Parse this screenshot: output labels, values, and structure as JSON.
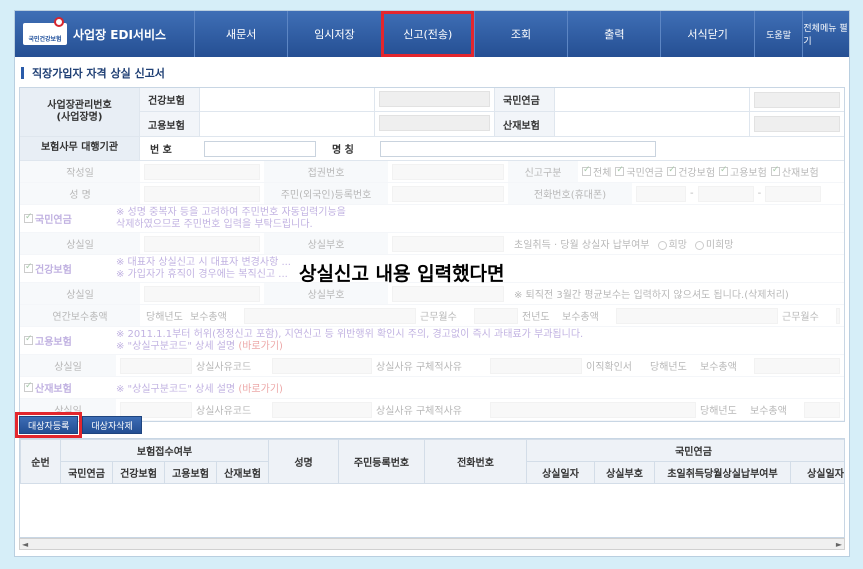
{
  "nav": {
    "logo_badge": "국민건강보험",
    "title": "사업장 EDI서비스",
    "items": [
      {
        "label": "새문서"
      },
      {
        "label": "임시저장"
      },
      {
        "label": "신고(전송)"
      },
      {
        "label": "조회"
      },
      {
        "label": "출력"
      },
      {
        "label": "서식닫기"
      }
    ],
    "small_items": [
      {
        "label": "도움말"
      },
      {
        "label": "전체메뉴 펼기"
      }
    ]
  },
  "page_title": "직장가입자 자격 상실 신고서",
  "form": {
    "biz_mgmt_label": "사업장관리번호\n(사업장명)",
    "health_label": "건강보험",
    "pension_label": "국민연금",
    "employment_label": "고용보험",
    "industrial_label": "산재보험",
    "agency_label": "보험사무 대행기관",
    "number_label": "번 호",
    "name_label": "명 칭"
  },
  "faded": {
    "date_label": "작성일",
    "receive_date_label": "접권번호",
    "report_type_label": "신고구분",
    "all": "전체",
    "pension": "국민연금",
    "health": "건강보험",
    "employment": "고용보험",
    "industrial": "산재보험",
    "name_label": "성 명",
    "rrn_label": "주민(외국인)등록번호",
    "phone_label": "전화번호(휴대폰)",
    "dash": "-",
    "sec_pension": "국민연금",
    "pension_note": "※ 성명 중복자 등을 고려하여 주민번호 자동입력기능을\n   삭제하였으므로 주민번호 입력을 부탁드립니다.",
    "loss_date": "상실일",
    "loss_code": "상실부호",
    "first_acq": "초일취득 · 당월 상실자 납부여부",
    "hope": "희망",
    "no_hope": "미희망",
    "sec_health": "건강보험",
    "health_note": "※ 대표자 상실신고 시 대표자 변경사항 ...\n※ 가입자가 휴직이 경우에는 복직신고 ...",
    "loss_code2": "상실부호",
    "reward_note": "※ 퇴직전 3월간 평균보수는 입력하지 않으셔도 됩니다.(삭제처리)",
    "annual_pay": "연간보수총액",
    "this_year": "당해년도",
    "pay_total": "보수총액",
    "work_months": "근무월수",
    "prev_year": "전년도",
    "pay_total2": "보수총액",
    "work_months2": "근무월수",
    "sec_employment": "고용보험",
    "emp_note": "※ 2011.1.1부터 허위(정정신고 포함), 지연신고 등 위반행위 확인시 주의, 경고없이 즉시 과태료가 부과됩니다.\n※ \"상실구분코드\" 상세 설명",
    "shortcut": "(바로가기)",
    "loss_date2": "상실일",
    "reason_code": "상실사유코드",
    "reason_detail": "상실사유 구체적사유",
    "leave_confirm": "이직확인서",
    "this_year2": "당해년도",
    "pay_total3": "보수총액",
    "sec_industrial": "산재보험",
    "ind_note": "※ \"상실구분코드\" 상세 설명",
    "shortcut2": "(바로가기)",
    "loss_date3": "상실일",
    "reason_code2": "상실사유코드",
    "reason_detail2": "상실사유 구체적사유",
    "this_year3": "당해년도",
    "pay_total4": "보수총액"
  },
  "caption": "상실신고 내용 입력했다면",
  "buttons": {
    "register": "대상자등록",
    "delete": "대상자삭제"
  },
  "grid": {
    "seq": "순번",
    "insurance_accept": "보험접수여부",
    "sub_pension": "국민연금",
    "sub_health": "건강보험",
    "sub_employment": "고용보험",
    "sub_industrial": "산재보험",
    "name": "성명",
    "rrn": "주민등록번호",
    "phone": "전화번호",
    "pension_group": "국민연금",
    "loss_date": "상실일자",
    "loss_code": "상실부호",
    "first_acq": "초일취득당월상실납부여부",
    "loss_date2": "상실일자"
  },
  "scroll": {
    "left": "◄",
    "right": "►"
  },
  "colors": {
    "nav_bg": "#2f5ca3",
    "highlight": "#e3262d",
    "note_purple": "#6c48b9"
  }
}
